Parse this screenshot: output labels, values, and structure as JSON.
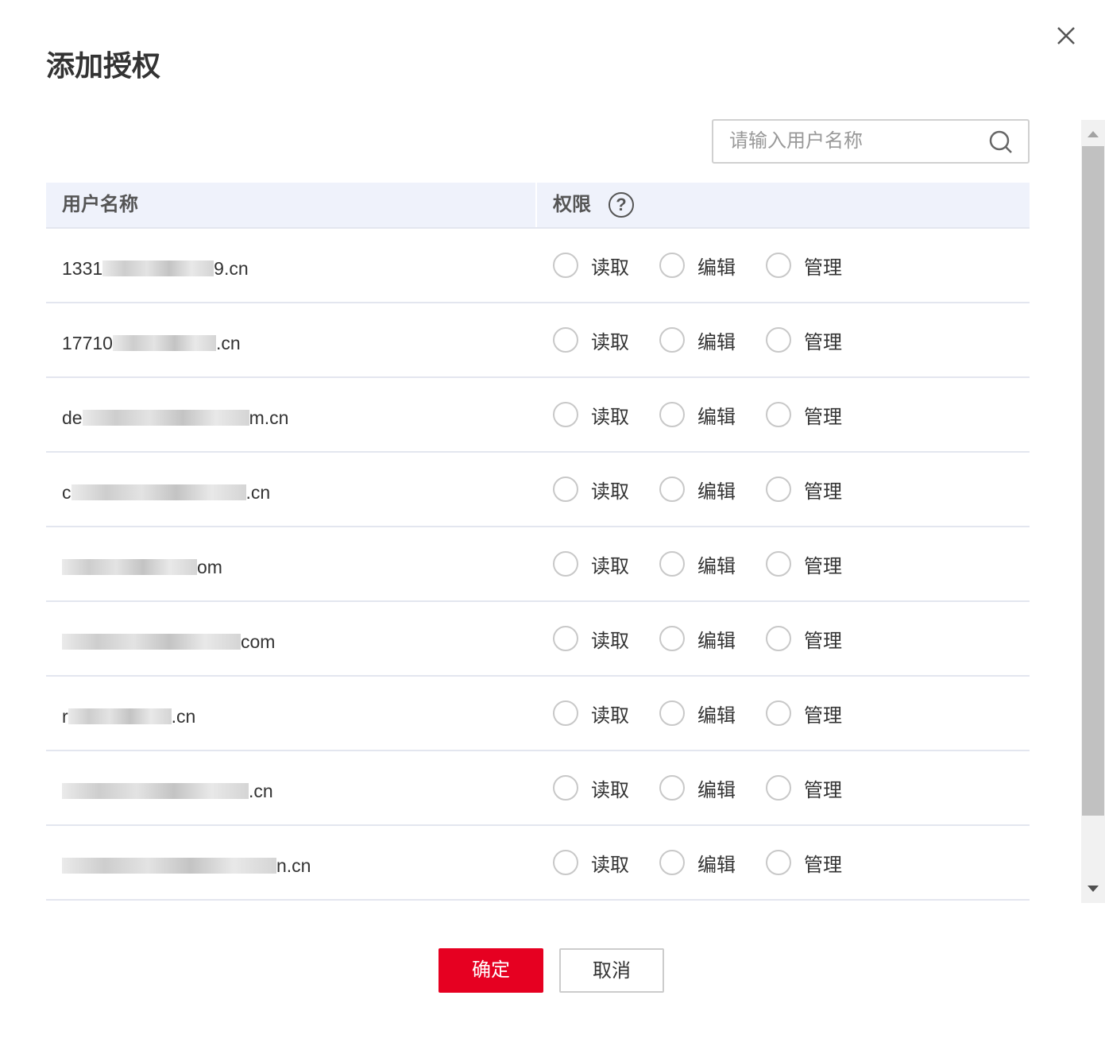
{
  "dialog": {
    "title": "添加授权",
    "close_icon": "close-icon"
  },
  "search": {
    "placeholder": "请输入用户名称",
    "value": ""
  },
  "table": {
    "headers": {
      "username": "用户名称",
      "permission": "权限",
      "help": "?"
    },
    "permission_options": [
      "读取",
      "编辑",
      "管理"
    ],
    "rows": [
      {
        "prefix": "1331",
        "suffix": "9.cn"
      },
      {
        "prefix": "17710",
        "suffix": ".cn"
      },
      {
        "prefix": "de",
        "suffix": "m.cn"
      },
      {
        "prefix": "c",
        "suffix": ".cn"
      },
      {
        "prefix": "",
        "suffix": "om"
      },
      {
        "prefix": "",
        "suffix": "com"
      },
      {
        "prefix": "r",
        "suffix": ".cn"
      },
      {
        "prefix": "",
        "suffix": ".cn"
      },
      {
        "prefix": "",
        "suffix": "n.cn"
      }
    ]
  },
  "buttons": {
    "confirm": "确定",
    "cancel": "取消"
  },
  "colors": {
    "primary": "#e60021",
    "header_bg": "#eff2fb"
  }
}
